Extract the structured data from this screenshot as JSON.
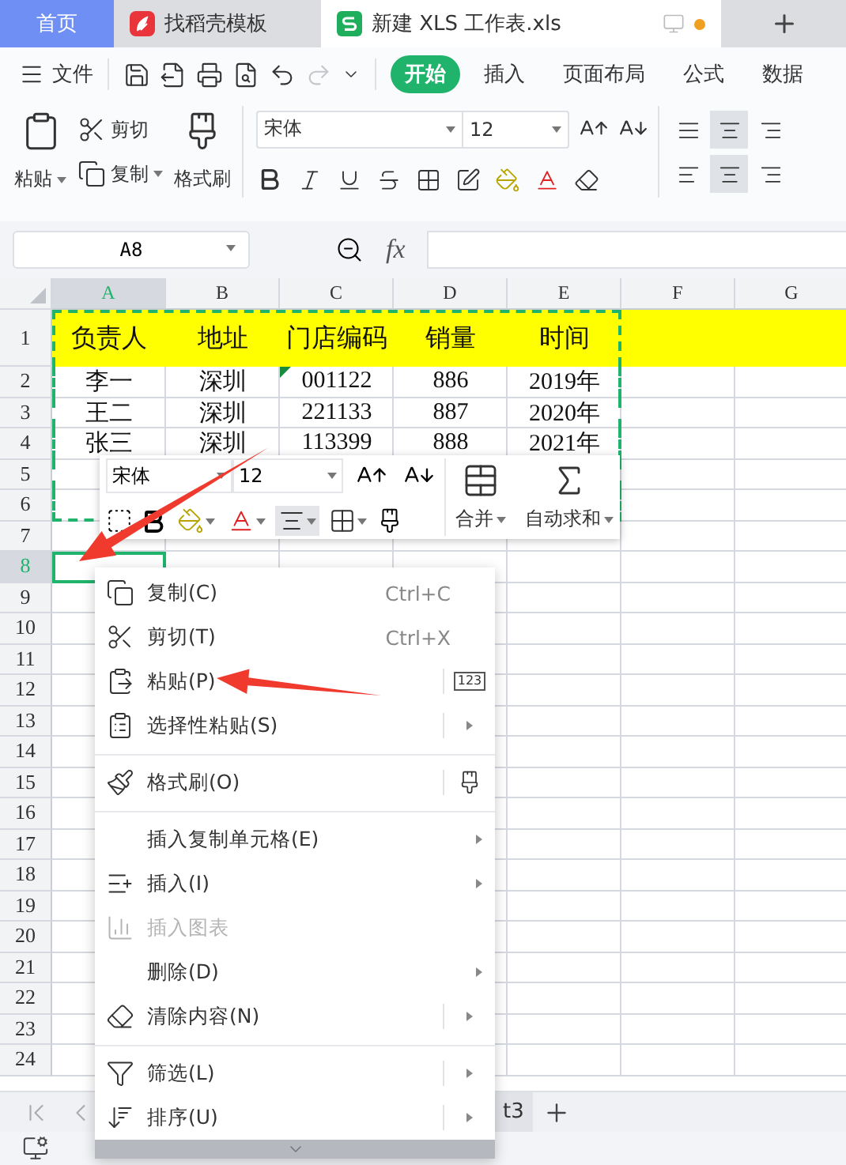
{
  "tabs": [
    {
      "kind": "home",
      "label": "首页",
      "selected": false,
      "unsaved": false
    },
    {
      "kind": "template",
      "label": "找稻壳模板",
      "selected": false,
      "unsaved": false
    },
    {
      "kind": "document",
      "label": "新建 XLS 工作表.xls",
      "selected": true,
      "unsaved": true
    }
  ],
  "file_menu": {
    "label": "文件"
  },
  "quick_access": [
    {
      "kind": "save",
      "disabled": false
    },
    {
      "kind": "export",
      "disabled": false
    },
    {
      "kind": "print",
      "disabled": false
    },
    {
      "kind": "preview",
      "disabled": false
    },
    {
      "kind": "undo",
      "disabled": false
    },
    {
      "kind": "redo",
      "disabled": true
    },
    {
      "kind": "more",
      "disabled": false
    }
  ],
  "ribbon_tabs": [
    {
      "label": "开始",
      "selected": true
    },
    {
      "label": "插入",
      "selected": false
    },
    {
      "label": "页面布局",
      "selected": false
    },
    {
      "label": "公式",
      "selected": false
    },
    {
      "label": "数据",
      "selected": false
    }
  ],
  "clipboard": {
    "paste": "粘贴",
    "cut": "剪切",
    "copy": "复制",
    "format_painter": "格式刷"
  },
  "font": {
    "name": "宋体",
    "size": "12"
  },
  "formula_bar": {
    "cell": "A8",
    "function_label": "fx"
  },
  "sheet": {
    "columns": [
      {
        "label": "A",
        "selected": true,
        "copied": true
      },
      {
        "label": "B",
        "selected": false,
        "copied": true
      },
      {
        "label": "C",
        "selected": false,
        "copied": true
      },
      {
        "label": "D",
        "selected": false,
        "copied": true
      },
      {
        "label": "E",
        "selected": false,
        "copied": true
      },
      {
        "label": "F",
        "selected": false,
        "copied": false
      },
      {
        "label": "G",
        "selected": false,
        "copied": false
      }
    ],
    "rows": [
      {
        "kind": "header",
        "label": "1",
        "selected": false,
        "copied": true,
        "cells": [
          {
            "text": "负责人",
            "flagged": false
          },
          {
            "text": "地址",
            "flagged": false
          },
          {
            "text": "门店编码",
            "flagged": false
          },
          {
            "text": "销量",
            "flagged": false
          },
          {
            "text": "时间",
            "flagged": false
          }
        ]
      },
      {
        "kind": "data",
        "label": "2",
        "selected": false,
        "copied": true,
        "cells": [
          {
            "text": "李一",
            "flagged": false
          },
          {
            "text": "深圳",
            "flagged": false
          },
          {
            "text": "001122",
            "flagged": true
          },
          {
            "text": "886",
            "flagged": false
          },
          {
            "text": "2019年",
            "flagged": false
          }
        ]
      },
      {
        "kind": "data",
        "label": "3",
        "selected": false,
        "copied": true,
        "cells": [
          {
            "text": "王二",
            "flagged": false
          },
          {
            "text": "深圳",
            "flagged": false
          },
          {
            "text": "221133",
            "flagged": false
          },
          {
            "text": "887",
            "flagged": false
          },
          {
            "text": "2020年",
            "flagged": false
          }
        ]
      },
      {
        "kind": "data",
        "label": "4",
        "selected": false,
        "copied": true,
        "cells": [
          {
            "text": "张三",
            "flagged": false
          },
          {
            "text": "深圳",
            "flagged": false
          },
          {
            "text": "113399",
            "flagged": false
          },
          {
            "text": "888",
            "flagged": false
          },
          {
            "text": "2021年",
            "flagged": false
          }
        ]
      },
      {
        "kind": "data",
        "label": "5",
        "selected": false,
        "copied": true
      },
      {
        "kind": "data",
        "label": "6",
        "selected": false,
        "copied": true
      },
      {
        "kind": "data",
        "label": "7",
        "selected": false,
        "copied": false
      },
      {
        "kind": "data",
        "label": "8",
        "selected": true,
        "copied": false
      },
      {
        "kind": "data",
        "label": "9",
        "selected": false,
        "copied": false
      },
      {
        "kind": "data",
        "label": "10",
        "selected": false,
        "copied": false
      },
      {
        "kind": "data",
        "label": "11",
        "selected": false,
        "copied": false
      },
      {
        "kind": "data",
        "label": "12",
        "selected": false,
        "copied": false
      },
      {
        "kind": "data",
        "label": "13",
        "selected": false,
        "copied": false
      },
      {
        "kind": "data",
        "label": "14",
        "selected": false,
        "copied": false
      },
      {
        "kind": "data",
        "label": "15",
        "selected": false,
        "copied": false
      },
      {
        "kind": "data",
        "label": "16",
        "selected": false,
        "copied": false
      },
      {
        "kind": "data",
        "label": "17",
        "selected": false,
        "copied": false
      },
      {
        "kind": "data",
        "label": "18",
        "selected": false,
        "copied": false
      },
      {
        "kind": "data",
        "label": "19",
        "selected": false,
        "copied": false
      },
      {
        "kind": "data",
        "label": "20",
        "selected": false,
        "copied": false
      },
      {
        "kind": "data",
        "label": "21",
        "selected": false,
        "copied": false
      },
      {
        "kind": "data",
        "label": "22",
        "selected": false,
        "copied": false
      },
      {
        "kind": "data",
        "label": "23",
        "selected": false,
        "copied": false
      },
      {
        "kind": "data",
        "label": "24",
        "selected": false,
        "copied": false
      }
    ]
  },
  "mini_toolbar": {
    "font": "宋体",
    "size": "12",
    "merge": "合并",
    "autosum": "自动求和"
  },
  "context_menu": {
    "items": [
      {
        "kind": "copy",
        "label": "复制(C)",
        "shortcut": "Ctrl+C",
        "disabled": false,
        "submenu": false
      },
      {
        "kind": "cut",
        "label": "剪切(T)",
        "shortcut": "Ctrl+X",
        "disabled": false,
        "submenu": false
      },
      {
        "kind": "paste",
        "label": "粘贴(P)",
        "disabled": false,
        "submenu": false,
        "side_label": "123"
      },
      {
        "kind": "paste-special",
        "label": "选择性粘贴(S)",
        "disabled": false,
        "submenu": true
      },
      {
        "kind": "separator"
      },
      {
        "kind": "painter",
        "label": "格式刷(O)",
        "disabled": false,
        "submenu": false
      },
      {
        "kind": "separator"
      },
      {
        "kind": "plain",
        "label": "插入复制单元格(E)",
        "disabled": false,
        "submenu": true
      },
      {
        "kind": "insert",
        "label": "插入(I)",
        "disabled": false,
        "submenu": true
      },
      {
        "kind": "chart",
        "label": "插入图表",
        "disabled": true,
        "submenu": false
      },
      {
        "kind": "plain",
        "label": "删除(D)",
        "disabled": false,
        "submenu": true
      },
      {
        "kind": "clear",
        "label": "清除内容(N)",
        "disabled": false,
        "submenu": true
      },
      {
        "kind": "separator"
      },
      {
        "kind": "filter",
        "label": "筛选(L)",
        "disabled": false,
        "submenu": true
      },
      {
        "kind": "sort",
        "label": "排序(U)",
        "disabled": false,
        "submenu": true
      }
    ]
  },
  "sheet_tabs": [
    {
      "label": "t3"
    }
  ]
}
